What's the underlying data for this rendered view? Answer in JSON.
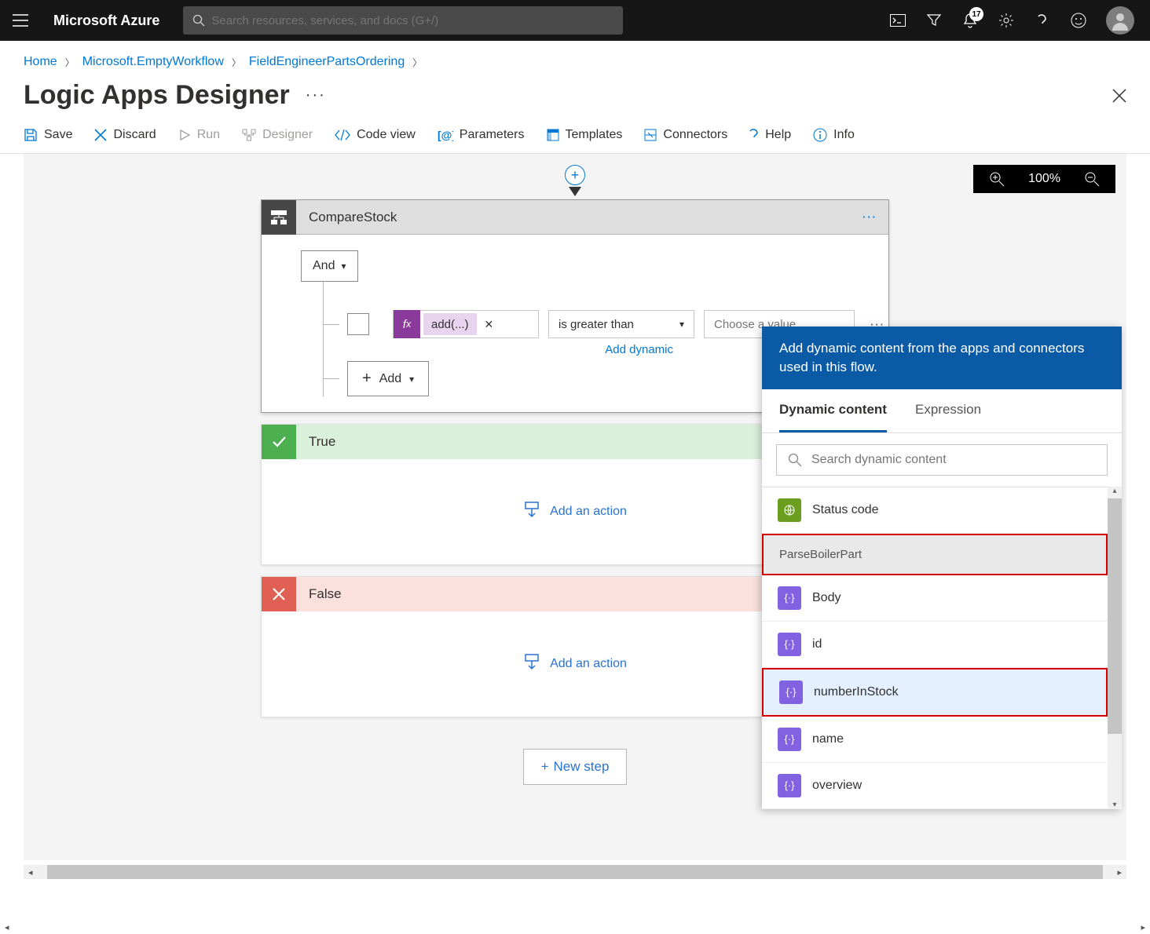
{
  "topbar": {
    "brand": "Microsoft Azure",
    "search_placeholder": "Search resources, services, and docs (G+/)",
    "notification_count": "17"
  },
  "breadcrumb": {
    "items": [
      "Home",
      "Microsoft.EmptyWorkflow",
      "FieldEngineerPartsOrdering"
    ]
  },
  "page": {
    "title": "Logic Apps Designer"
  },
  "toolbar": {
    "save": "Save",
    "discard": "Discard",
    "run": "Run",
    "designer": "Designer",
    "codeview": "Code view",
    "parameters": "Parameters",
    "templates": "Templates",
    "connectors": "Connectors",
    "help": "Help",
    "info": "Info"
  },
  "zoom": {
    "level": "100%"
  },
  "condition": {
    "title": "CompareStock",
    "and_label": "And",
    "fx_label": "add(...)",
    "operator": "is greater than",
    "value_placeholder": "Choose a value",
    "add_dynamic": "Add dynamic",
    "add_row": "Add"
  },
  "branches": {
    "true_label": "True",
    "false_label": "False",
    "add_action": "Add an action"
  },
  "newstep": "New step",
  "dynamic": {
    "header": "Add dynamic content from the apps and connectors used in this flow.",
    "tab_content": "Dynamic content",
    "tab_expr": "Expression",
    "search_placeholder": "Search dynamic content",
    "top_item": "Status code",
    "group_header": "ParseBoilerPart",
    "items": [
      "Body",
      "id",
      "numberInStock",
      "name",
      "overview"
    ]
  }
}
